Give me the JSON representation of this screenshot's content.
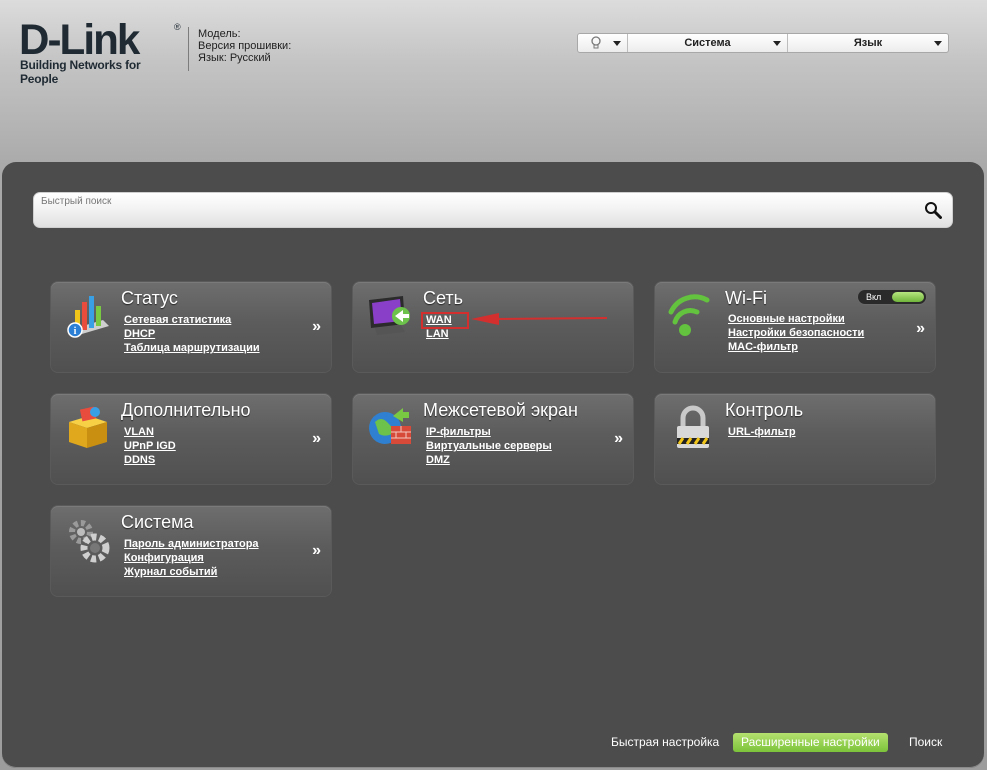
{
  "header": {
    "logo": "D-Link",
    "logo_reg": "®",
    "tagline": "Building Networks for People",
    "device_info": [
      "Модель:",
      "Версия прошивки:",
      "Язык: Русский"
    ]
  },
  "topbar": {
    "icon": "lightbulb-icon",
    "items": [
      "",
      "Система",
      "Язык"
    ]
  },
  "search": {
    "placeholder": "Быстрый поиск",
    "icon": "magnifier-icon"
  },
  "tiles": {
    "status": {
      "title": "Статус",
      "icon": "bar-chart-icon",
      "links": [
        "Сетевая статистика",
        "DHCP",
        "Таблица маршрутизации"
      ],
      "more": "»"
    },
    "network": {
      "title": "Сеть",
      "icon": "monitor-network-icon",
      "links": [
        "WAN",
        "LAN"
      ],
      "more": "»"
    },
    "wifi": {
      "title": "Wi-Fi",
      "icon": "wifi-icon",
      "toggle_label": "Вкл",
      "toggle_state": "on",
      "links": [
        "Основные настройки",
        "Настройки безопасности",
        "MAC-фильтр"
      ],
      "more": "»"
    },
    "advanced": {
      "title": "Дополнительно",
      "icon": "box-icon",
      "links": [
        "VLAN",
        "UPnP IGD",
        "DDNS"
      ],
      "more": "»"
    },
    "firewall": {
      "title": "Межсетевой экран",
      "icon": "globe-firewall-icon",
      "links": [
        "IP-фильтры",
        "Виртуальные серверы",
        "DMZ"
      ],
      "more": "»"
    },
    "control": {
      "title": "Контроль",
      "icon": "padlock-icon",
      "links": [
        "URL-фильтр"
      ]
    },
    "system": {
      "title": "Система",
      "icon": "gears-icon",
      "links": [
        "Пароль администратора",
        "Конфигурация",
        "Журнал событий"
      ],
      "more": "»"
    }
  },
  "bottom_nav": {
    "quick": "Быстрая настройка",
    "advanced": "Расширенные настройки",
    "search": "Поиск"
  },
  "colors": {
    "accent_green": "#7cc33a",
    "panel": "#4c4c4c",
    "highlight_red": "#d32f2f"
  }
}
